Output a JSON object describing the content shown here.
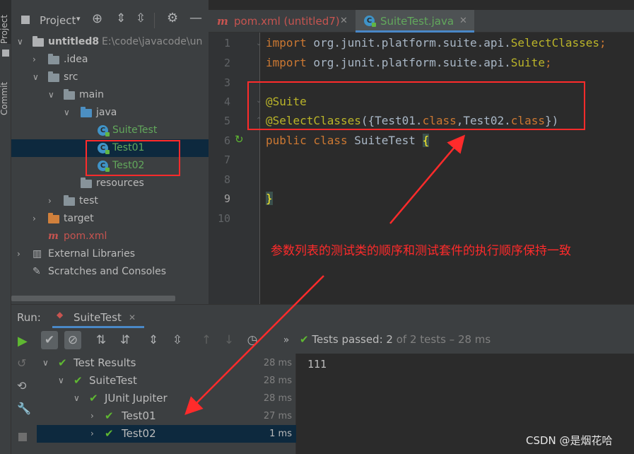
{
  "side_tabs": {
    "project": "Project",
    "commit": "Commit"
  },
  "project_toolbar": {
    "title": "Project"
  },
  "tree": {
    "root": {
      "name": "untitled8",
      "path": "E:\\code\\javacode\\un"
    },
    "idea": ".idea",
    "src": "src",
    "main": "main",
    "java": "java",
    "suite_test": "SuiteTest",
    "test01": "Test01",
    "test02": "Test02",
    "resources": "resources",
    "test": "test",
    "target": "target",
    "pom": "pom.xml",
    "external_libraries": "External Libraries",
    "scratches": "Scratches and Consoles"
  },
  "editor_tabs": [
    {
      "label": "pom.xml (untitled7)",
      "icon": "maven-icon"
    },
    {
      "label": "SuiteTest.java",
      "icon": "test-class-icon"
    }
  ],
  "code": {
    "line_numbers": [
      "1",
      "2",
      "3",
      "4",
      "5",
      "6",
      "7",
      "8",
      "9",
      "10"
    ],
    "l1_kw": "import",
    "l1_pkg": " org.junit.platform.suite.api.",
    "l1_cls": "SelectClasses",
    "l1_end": ";",
    "l2_kw": "import",
    "l2_pkg": " org.junit.platform.suite.api.",
    "l2_cls": "Suite",
    "l2_end": ";",
    "l4": "@Suite",
    "l5_ann": "@SelectClasses",
    "l5_a": "({Test01.",
    "l5_kw1": "class",
    "l5_b": ",Test02.",
    "l5_kw2": "class",
    "l5_c": "})",
    "l6_kw": "public class",
    "l6_name": " SuiteTest ",
    "l6_brace": "{",
    "l9": "}"
  },
  "run": {
    "label": "Run:",
    "config": "SuiteTest",
    "status_prefix": "Tests passed:",
    "status_count": "2",
    "status_suffix": "of 2 tests – 28 ms",
    "results": [
      {
        "label": "Test Results",
        "time": "28 ms"
      },
      {
        "label": "SuiteTest",
        "time": "28 ms"
      },
      {
        "label": "JUnit Jupiter",
        "time": "28 ms"
      },
      {
        "label": "Test01",
        "time": "27 ms"
      },
      {
        "label": "Test02",
        "time": "1 ms"
      }
    ],
    "console_output": "111"
  },
  "annotation_note": "参数列表的测试类的顺序和测试套件的执行顺序保持一致",
  "watermark": "CSDN @是烟花哈",
  "colors": {
    "accent_red": "#ff2b2b",
    "pass_green": "#5fb832",
    "selection": "#0d293e"
  }
}
